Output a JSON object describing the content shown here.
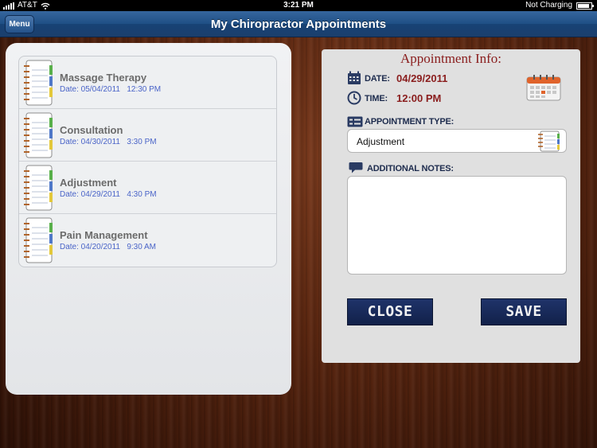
{
  "status_bar": {
    "carrier": "AT&T",
    "time": "3:21 PM",
    "battery_text": "Not Charging",
    "battery_level": 0.85
  },
  "nav": {
    "menu_label": "Menu",
    "title": "My Chiropractor Appointments"
  },
  "appointments": [
    {
      "title": "Massage Therapy",
      "date": "Date: 05/04/2011   12:30 PM"
    },
    {
      "title": "Consultation",
      "date": "Date: 04/30/2011   3:30 PM"
    },
    {
      "title": "Adjustment",
      "date": "Date: 04/29/2011   4:30 PM"
    },
    {
      "title": "Pain Management",
      "date": "Date: 04/20/2011   9:30 AM"
    }
  ],
  "info": {
    "title": "Appointment Info:",
    "date_label": "DATE:",
    "date_value": "04/29/2011",
    "time_label": "TIME:",
    "time_value": "12:00 PM",
    "type_label": "APPOINTMENT TYPE:",
    "type_value": "Adjustment",
    "notes_label": "ADDITIONAL NOTES:",
    "notes_value": "",
    "close_label": "CLOSE",
    "save_label": "SAVE"
  },
  "icons": {
    "calendar": "calendar-icon",
    "clock": "clock-icon",
    "type": "list-icon",
    "notes": "speech-bubble-icon",
    "notebook": "notebook-icon"
  },
  "colors": {
    "accent_dark_red": "#8a1d1d",
    "label_navy": "#1e2c4e",
    "date_blue": "#4a64c8",
    "nav_blue": "#1f4f85",
    "button_navy": "#1a2c5d"
  }
}
